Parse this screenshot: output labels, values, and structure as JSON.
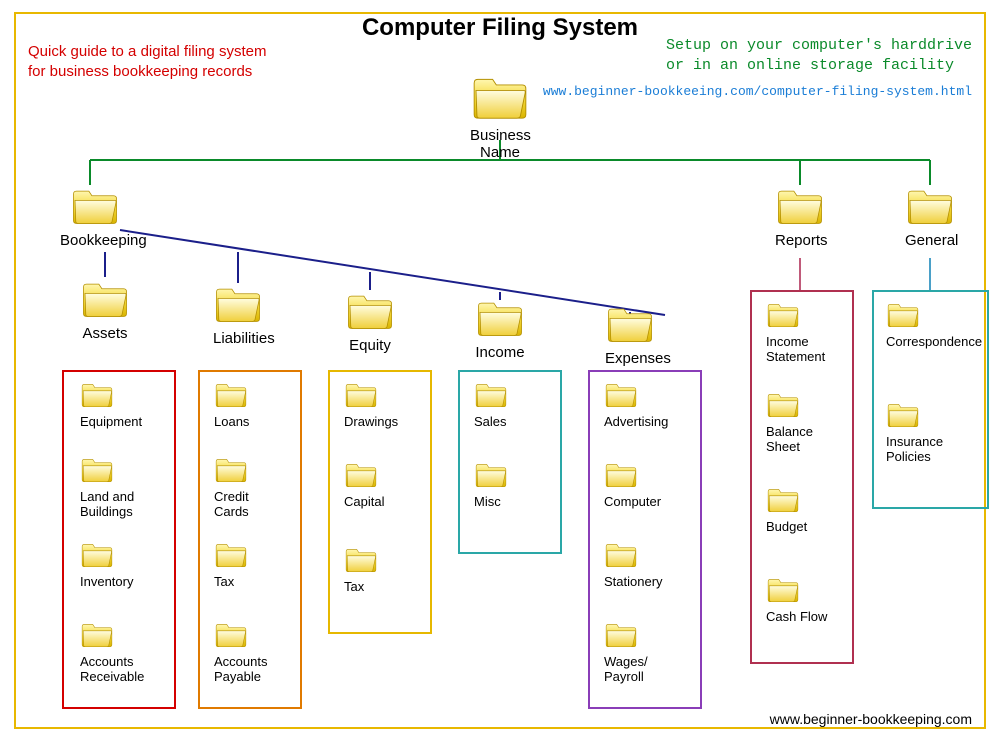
{
  "title": "Computer Filing System",
  "note_red": "Quick guide to a digital filing system\nfor business bookkeeping records",
  "note_green": "Setup on your computer's harddrive\nor in an online storage facility",
  "link": "www.beginner-bookkeeing.com/computer-filing-system.html",
  "footer": "www.beginner-bookkeeping.com",
  "root": {
    "label": "Business Name"
  },
  "main": {
    "bookkeeping": {
      "label": "Bookkeeping"
    },
    "reports": {
      "label": "Reports"
    },
    "general": {
      "label": "General"
    }
  },
  "sub": {
    "assets": {
      "label": "Assets",
      "items": [
        "Equipment",
        "Land and\nBuildings",
        "Inventory",
        "Accounts\nReceivable"
      ],
      "box": "#d40000"
    },
    "liabilities": {
      "label": "Liabilities",
      "items": [
        "Loans",
        "Credit\nCards",
        "Tax",
        "Accounts\nPayable"
      ],
      "box": "#e07a00"
    },
    "equity": {
      "label": "Equity",
      "items": [
        "Drawings",
        "Capital",
        "Tax"
      ],
      "box": "#e6b800"
    },
    "income": {
      "label": "Income",
      "items": [
        "Sales",
        "Misc"
      ],
      "box": "#2aa7a7"
    },
    "expenses": {
      "label": "Expenses",
      "items": [
        "Advertising",
        "Computer",
        "Stationery",
        "Wages/\nPayroll"
      ],
      "box": "#8a3db8"
    },
    "reports": {
      "items": [
        "Income\nStatement",
        "Balance\nSheet",
        "Budget",
        "Cash Flow"
      ],
      "box": "#b03050"
    },
    "general": {
      "items": [
        "Correspondence",
        "Insurance\nPolicies"
      ],
      "box": "#2aa7a7"
    }
  },
  "colors": {
    "connector_green": "#0a8a2a",
    "connector_blue": "#1b1f8a",
    "connector_report": "#c05a7a",
    "connector_general": "#4aa0c8"
  }
}
